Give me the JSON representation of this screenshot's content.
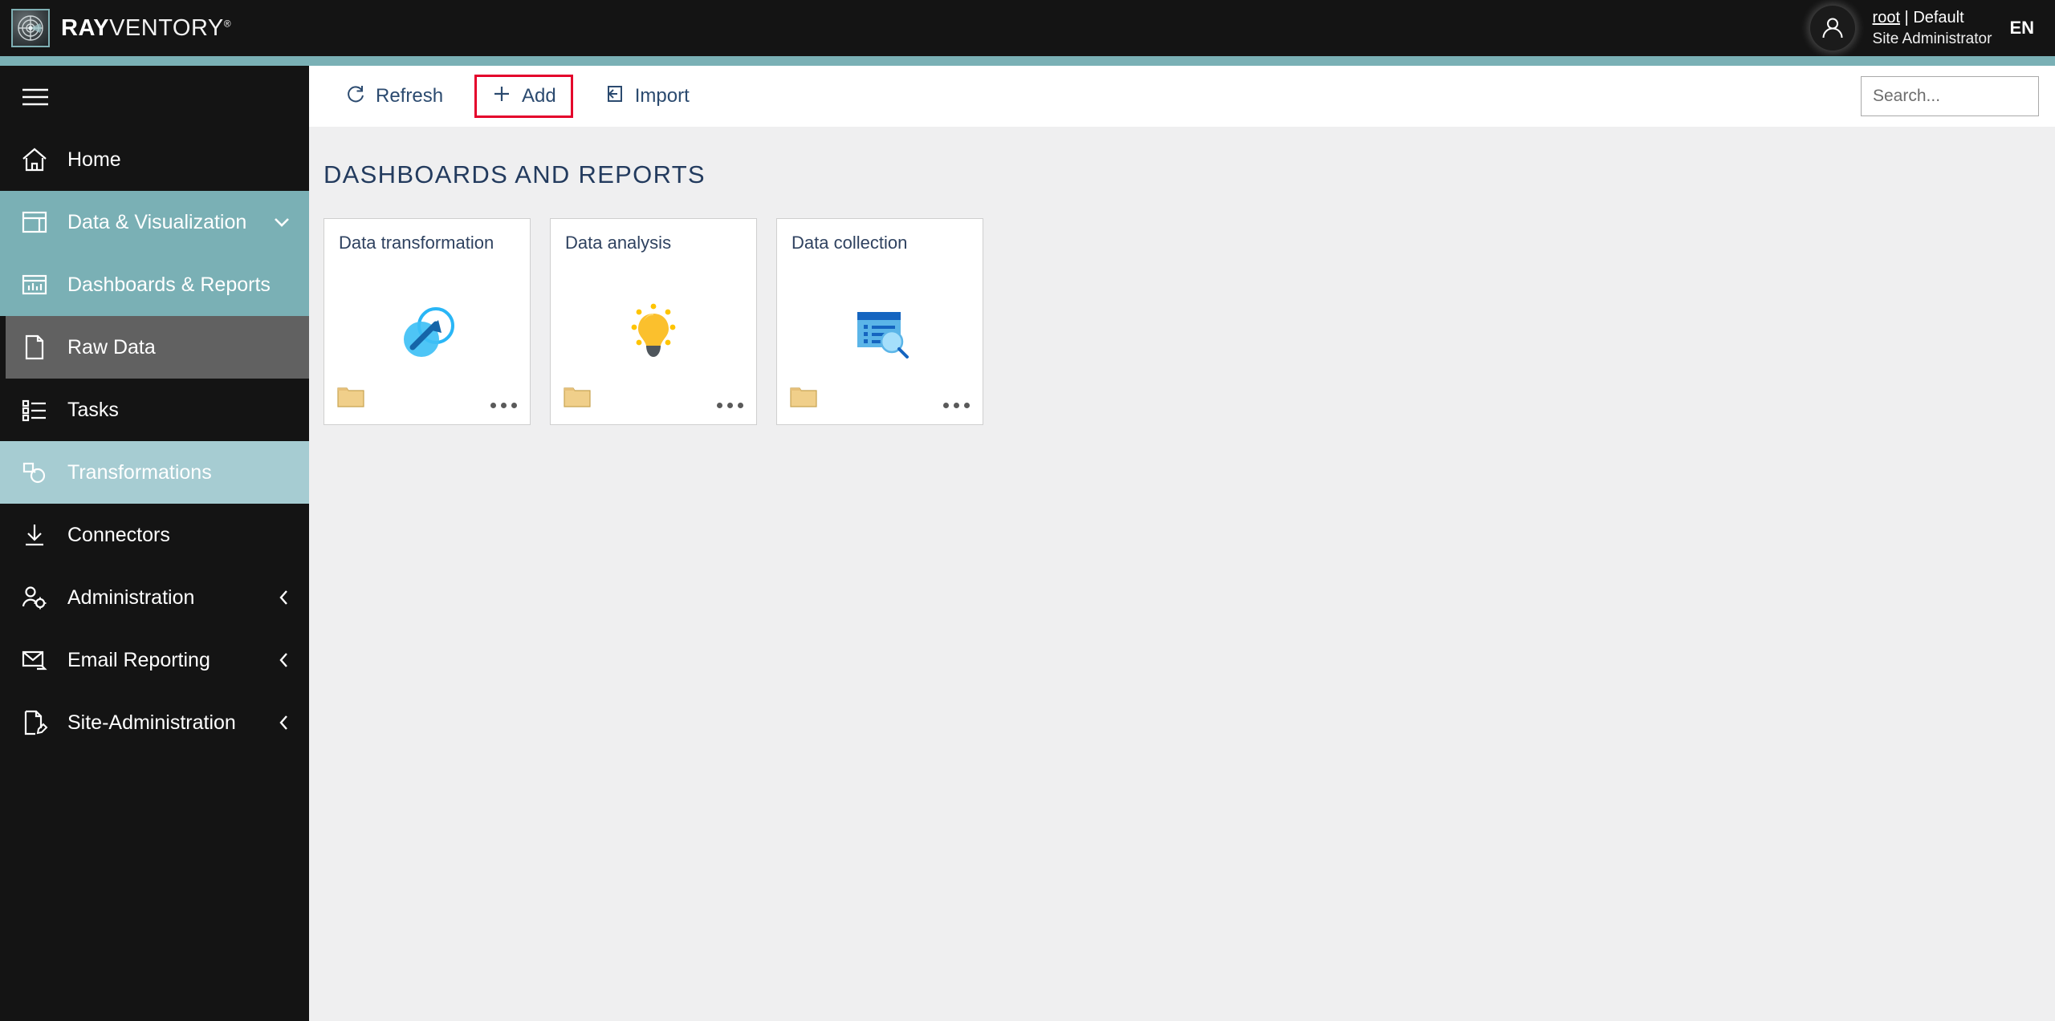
{
  "header": {
    "brand_bold": "RAY",
    "brand_light": "VENTORY",
    "brand_registered": "®",
    "logo_icon": "radar-logo-icon",
    "avatar_icon": "user-avatar-icon",
    "user_name": "root",
    "user_separator": " | ",
    "user_tenant": "Default",
    "user_role": "Site Administrator",
    "language": "EN"
  },
  "sidebar": {
    "menu_toggle_icon": "hamburger-icon",
    "items": [
      {
        "label": "Home",
        "icon": "home-icon",
        "state": "normal",
        "chevron": "none"
      },
      {
        "label": "Data & Visualization",
        "icon": "layout-icon",
        "state": "group",
        "chevron": "down"
      },
      {
        "label": "Dashboards & Reports",
        "icon": "chart-window-icon",
        "state": "group",
        "chevron": "none"
      },
      {
        "label": "Raw Data",
        "icon": "document-icon",
        "state": "selected",
        "chevron": "none"
      },
      {
        "label": "Tasks",
        "icon": "task-list-icon",
        "state": "normal",
        "chevron": "none"
      },
      {
        "label": "Transformations",
        "icon": "transformations-icon",
        "state": "hovered",
        "chevron": "none"
      },
      {
        "label": "Connectors",
        "icon": "download-arrow-icon",
        "state": "normal",
        "chevron": "none"
      },
      {
        "label": "Administration",
        "icon": "user-gear-icon",
        "state": "normal",
        "chevron": "left"
      },
      {
        "label": "Email Reporting",
        "icon": "email-arrow-icon",
        "state": "normal",
        "chevron": "left"
      },
      {
        "label": "Site-Administration",
        "icon": "document-pen-icon",
        "state": "normal",
        "chevron": "left"
      }
    ]
  },
  "toolbar": {
    "refresh_label": "Refresh",
    "refresh_icon": "refresh-icon",
    "add_label": "Add",
    "add_icon": "plus-icon",
    "import_label": "Import",
    "import_icon": "import-icon",
    "highlighted_button": "Add"
  },
  "search": {
    "placeholder": "Search...",
    "value": "",
    "icon": "search-icon"
  },
  "main": {
    "page_title": "DASHBOARDS AND REPORTS",
    "tiles": [
      {
        "title": "Data transformation",
        "art": "data-transformation-art",
        "folder_icon": "folder-icon",
        "more_icon": "more-options-icon"
      },
      {
        "title": "Data analysis",
        "art": "lightbulb-art",
        "folder_icon": "folder-icon",
        "more_icon": "more-options-icon"
      },
      {
        "title": "Data collection",
        "art": "data-collection-art",
        "folder_icon": "folder-icon",
        "more_icon": "more-options-icon"
      }
    ]
  },
  "colors": {
    "header_bg": "#141414",
    "accent_teal": "#7ab0b5",
    "accent_teal_light": "#a6ccd2",
    "selected_gray": "#616161",
    "content_bg": "#efeff0",
    "highlight_red": "#e4002b",
    "title_navy": "#233b5e"
  }
}
